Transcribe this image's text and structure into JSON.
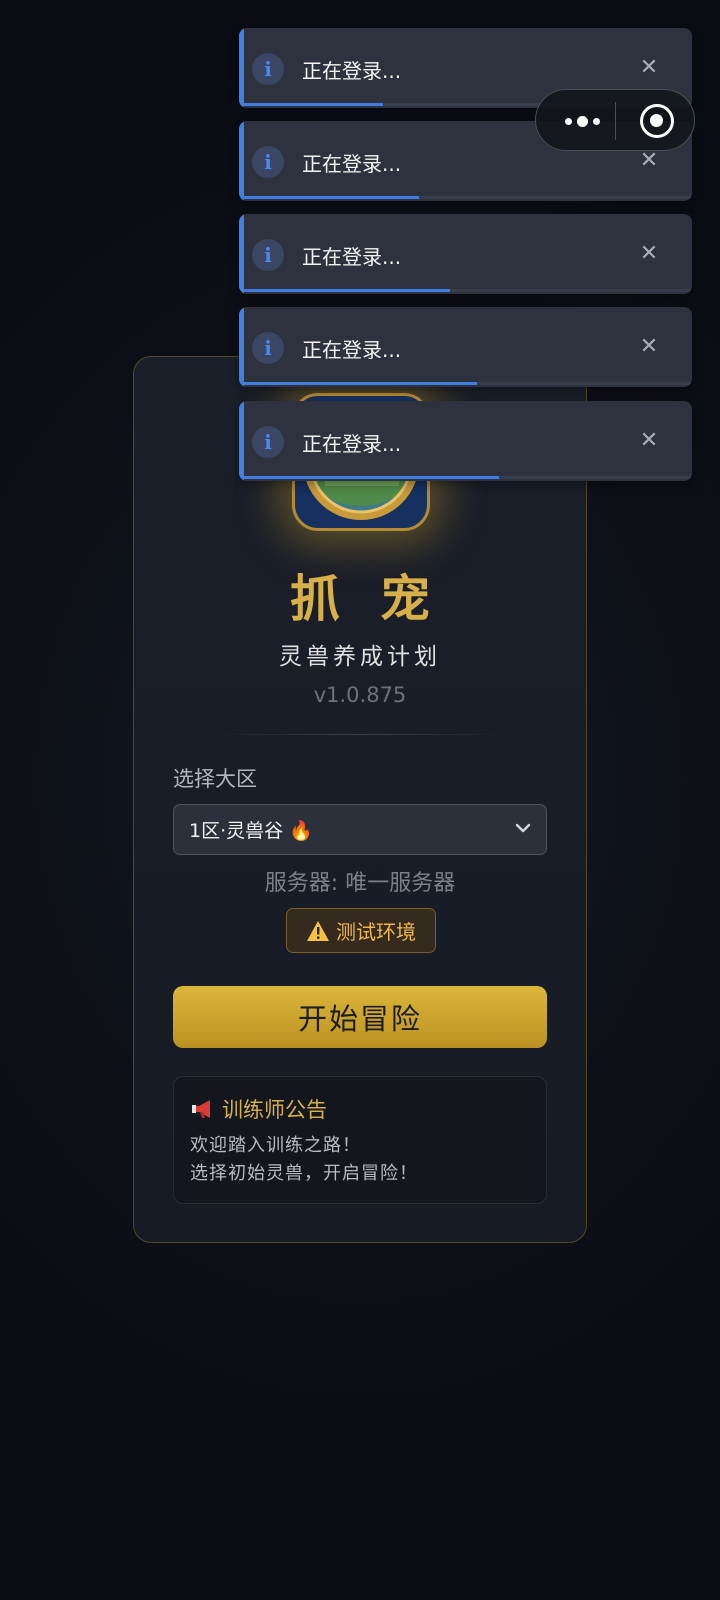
{
  "app": {
    "title": "抓宠",
    "subtitle": "灵兽养成计划",
    "version": "v1.0.875"
  },
  "region": {
    "label": "选择大区",
    "selected": "1区·灵兽谷 🔥",
    "server_text": "服务器: 唯一服务器",
    "env_badge": "测试环境"
  },
  "start_button": {
    "label": "开始冒险"
  },
  "notice": {
    "title": "训练师公告",
    "lines": [
      "欢迎踏入训练之路！",
      "选择初始灵兽，开启冒险！"
    ]
  },
  "toasts": [
    {
      "message": "正在登录...",
      "icon": "info-icon",
      "progress": 0.31
    },
    {
      "message": "正在登录...",
      "icon": "info-icon",
      "progress": 0.39
    },
    {
      "message": "正在登录...",
      "icon": "info-icon",
      "progress": 0.46
    },
    {
      "message": "正在登录...",
      "icon": "info-icon",
      "progress": 0.52
    },
    {
      "message": "正在登录...",
      "icon": "info-icon",
      "progress": 0.57
    }
  ],
  "colors": {
    "accent_gold": "#d8b04a",
    "info_blue": "#4080e0",
    "warning": "#f0b84a"
  }
}
